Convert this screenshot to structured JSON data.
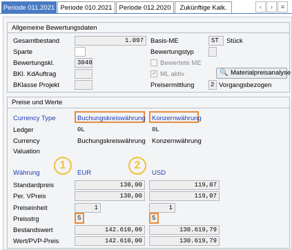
{
  "tabs": [
    "Periode 011.2021",
    "Periode 010.2021",
    "Periode 012.2020",
    "Zukünftige Kalk."
  ],
  "nav_icons": [
    "chevron-left-icon",
    "chevron-right-icon",
    "menu-icon"
  ],
  "nav_glyphs": [
    "‹",
    "›",
    "≡"
  ],
  "general": {
    "title": "Allgemeine Bewertungsdaten",
    "gesamtbestand_label": "Gesamtbestand",
    "gesamtbestand_value": "1.097",
    "basis_me_label": "Basis-ME",
    "basis_me_value": "ST",
    "basis_me_text": "Stück",
    "sparte_label": "Sparte",
    "sparte_value": "",
    "bewertungstyp_label": "Bewertungstyp",
    "bewertungstyp_value": "",
    "bewertungskl_label": "Bewertungskl.",
    "bewertungskl_value": "3040",
    "bewertete_me_label": "Bewertete ME",
    "bewertete_me_checked": false,
    "bkl_kdauftrag_label": "BKl. KdAuftrag",
    "bkl_kdauftrag_value": "",
    "ml_aktiv_label": "ML aktiv",
    "ml_aktiv_checked": true,
    "materialpreisanalyse_label": "Materialpreisanalyse",
    "bklasse_projekt_label": "BKlasse Projekt",
    "bklasse_projekt_value": "",
    "preisermittlung_label": "Preisermittlung",
    "preisermittlung_value": "2",
    "preisermittlung_text": "Vorgangsbezogen"
  },
  "prices": {
    "title": "Preise und Werte",
    "currency_type_label": "Currency Type",
    "currency_type_1": "Buchungskreiswährung",
    "currency_type_2": "Konzernwährung",
    "ledger_label": "Ledger",
    "ledger_1": "0L",
    "ledger_2": "0L",
    "currency_label": "Currency",
    "currency_1": "Buchungskreiswährung",
    "currency_2": "Konzernwährung",
    "valuation_label": "Valuation",
    "waehrung_label": "Währung",
    "waehrung_1": "EUR",
    "waehrung_2": "USD",
    "marker_1": "1",
    "marker_2": "2",
    "standardpreis_label": "Standardpreis",
    "standardpreis_1": "130,00",
    "standardpreis_2": "119,07",
    "per_vpreis_label": "Per. VPreis",
    "per_vpreis_1": "130,00",
    "per_vpreis_2": "119,07",
    "preiseinheit_label": "Preiseinheit",
    "preiseinheit_1": "1",
    "preiseinheit_2": "1",
    "preisstrg_label": "Preisstrg",
    "preisstrg_1": "S",
    "preisstrg_2": "S",
    "bestandswert_label": "Bestandswert",
    "bestandswert_1": "142.610,00",
    "bestandswert_2": "130.619,79",
    "wert_pvp_label": "Wert/PVP-Preis",
    "wert_pvp_1": "142.610,00",
    "wert_pvp_2": "130.619,79"
  },
  "colors": {
    "tab_active": "#4a7cc4",
    "highlight": "#e98b3a",
    "marker": "#f0c23a",
    "label_blue": "#1f3cb5"
  }
}
